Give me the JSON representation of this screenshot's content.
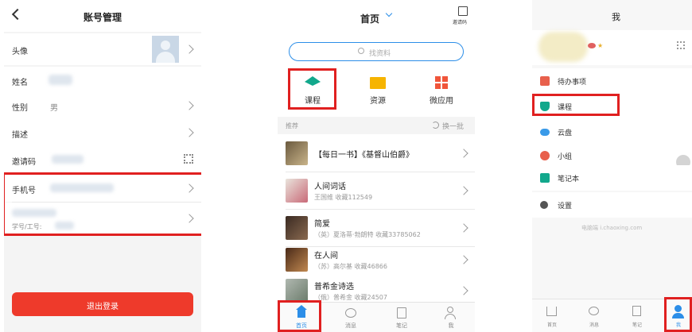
{
  "panel1": {
    "title": "账号管理",
    "rows": [
      {
        "label": "头像",
        "value": ""
      },
      {
        "label": "姓名",
        "value": ""
      },
      {
        "label": "性别",
        "value": "男"
      },
      {
        "label": "描述",
        "value": ""
      },
      {
        "label": "邀请码",
        "value": ""
      },
      {
        "label": "手机号",
        "value": ""
      },
      {
        "label": "",
        "value": "学号/工号:"
      }
    ],
    "logout_label": "退出登录"
  },
  "panel2": {
    "title": "首页",
    "scan_label": "邀请码",
    "search_placeholder": "找资料",
    "quick": [
      {
        "label": "课程",
        "icon": "graduation-cap-icon",
        "color": "#12a88c"
      },
      {
        "label": "资源",
        "icon": "folder-icon",
        "color": "#f6b400"
      },
      {
        "label": "微应用",
        "icon": "apps-grid-icon",
        "color": "#f0553a"
      }
    ],
    "recommend_label": "推荐",
    "refresh_label": "换一批",
    "books": [
      {
        "title": "【每日一书】《基督山伯爵》",
        "sub": ""
      },
      {
        "title": "人间词话",
        "sub": "王国维  收藏112549"
      },
      {
        "title": "简爱",
        "sub": "（英）夏洛蒂·勃朗特  收藏33785062"
      },
      {
        "title": "在人间",
        "sub": "（苏）高尔基  收藏46866"
      },
      {
        "title": "普希金诗选",
        "sub": "（俄）普希金  收藏24507"
      }
    ],
    "tabs": [
      {
        "label": "首页"
      },
      {
        "label": "消息"
      },
      {
        "label": "笔记"
      },
      {
        "label": "我"
      }
    ]
  },
  "panel3": {
    "title": "我",
    "menu": [
      {
        "label": "待办事项",
        "color": "#e8604c"
      },
      {
        "label": "课程",
        "color": "#12a88c"
      },
      {
        "label": "云盘",
        "color": "#3a9ae8"
      },
      {
        "label": "小组",
        "color": "#e8604c"
      },
      {
        "label": "笔记本",
        "color": "#12a88c"
      },
      {
        "label": "设置",
        "color": "#555555"
      }
    ],
    "footer": "电脑端 i.chaoxing.com",
    "tabs": [
      {
        "label": "首页"
      },
      {
        "label": "消息"
      },
      {
        "label": "笔记"
      },
      {
        "label": "我"
      }
    ]
  },
  "colors": {
    "accent_red": "#e02020",
    "logout_red": "#ee3a2b",
    "brand_blue": "#2c8ee8",
    "teal": "#12a88c"
  }
}
